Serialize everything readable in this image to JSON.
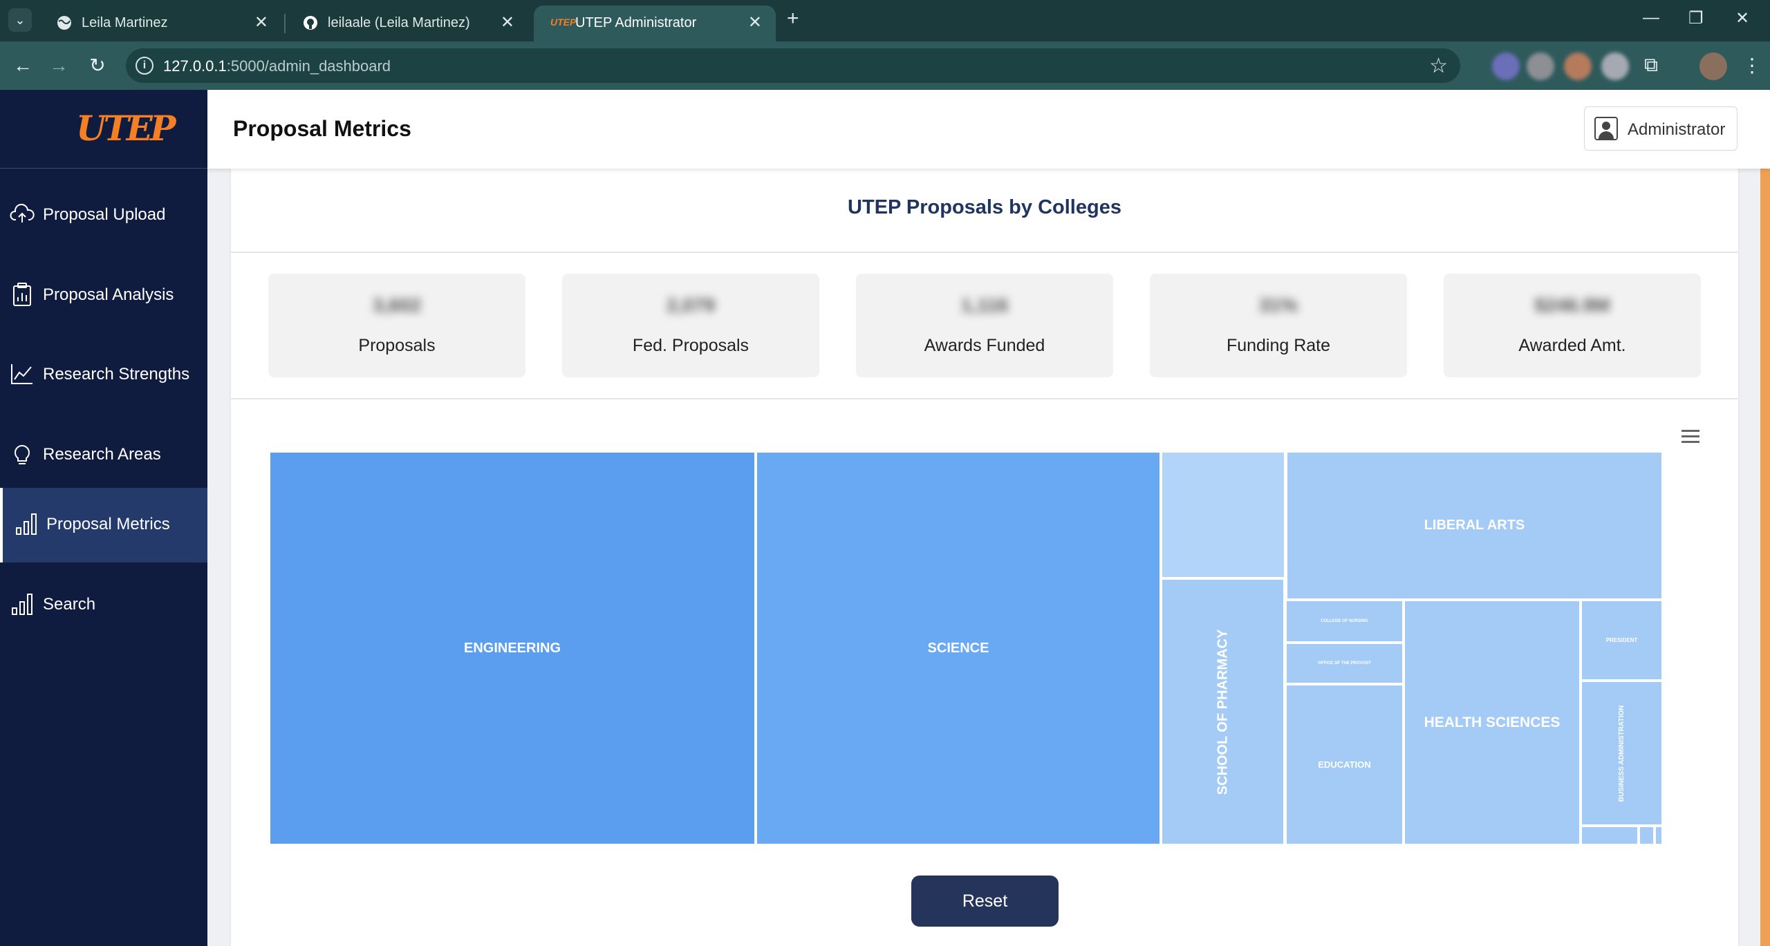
{
  "browser": {
    "tabs": [
      {
        "title": "Leila Martinez",
        "icon": "globe-icon"
      },
      {
        "title": "leilaale (Leila Martinez)",
        "icon": "github-icon"
      },
      {
        "title": "UTEP Administrator",
        "icon": "utep-favicon"
      }
    ],
    "url_host": "127.0.0.1",
    "url_path": ":5000/admin_dashboard"
  },
  "sidebar": {
    "logo": "UTEP",
    "items": [
      {
        "label": "Proposal Upload",
        "icon": "cloud-upload-icon"
      },
      {
        "label": "Proposal Analysis",
        "icon": "clipboard-chart-icon"
      },
      {
        "label": "Research Strengths",
        "icon": "line-chart-icon"
      },
      {
        "label": "Research Areas",
        "icon": "lightbulb-icon"
      },
      {
        "label": "Proposal Metrics",
        "icon": "bar-chart-icon",
        "active": true
      },
      {
        "label": "Search",
        "icon": "bar-chart-icon"
      }
    ]
  },
  "header": {
    "title": "Proposal Metrics",
    "user_label": "Administrator"
  },
  "card": {
    "title": "UTEP Proposals by Colleges",
    "metrics": [
      {
        "label": "Proposals",
        "value": "3,602"
      },
      {
        "label": "Fed. Proposals",
        "value": "2,079"
      },
      {
        "label": "Awards Funded",
        "value": "1,116"
      },
      {
        "label": "Funding Rate",
        "value": "31%"
      },
      {
        "label": "Awarded Amt.",
        "value": "$246.9M"
      }
    ],
    "reset_label": "Reset"
  },
  "colors": {
    "sidebar_bg": "#0f1c3f",
    "active_item_bg": "#243a6b",
    "accent": "#f47f24",
    "treemap_dark": "#5b9ef0",
    "treemap_light": "#a3cbf6",
    "reset_button": "#25345a"
  },
  "chart_data": {
    "type": "treemap",
    "title": "",
    "nodes": [
      {
        "label": "ENGINEERING",
        "size": 1000
      },
      {
        "label": "SCIENCE",
        "size": 830
      },
      {
        "label": "LIBERAL ARTS",
        "size": 295
      },
      {
        "label": "SCHOOL OF PHARMACY",
        "size": 170
      },
      {
        "label": "HEALTH SCIENCES",
        "size": 215
      },
      {
        "label": "EDUCATION",
        "size": 115
      },
      {
        "label": "",
        "size": 80
      },
      {
        "label": "BUSINESS ADMINISTRATION",
        "size": 60
      },
      {
        "label": "PRESIDENT",
        "size": 32
      },
      {
        "label": "COLLEGE OF NURSING",
        "size": 28
      },
      {
        "label": "OFFICE OF THE PROVOST",
        "size": 24
      },
      {
        "label": "",
        "size": 9
      },
      {
        "label": "",
        "size": 2
      },
      {
        "label": "",
        "size": 1
      }
    ]
  }
}
